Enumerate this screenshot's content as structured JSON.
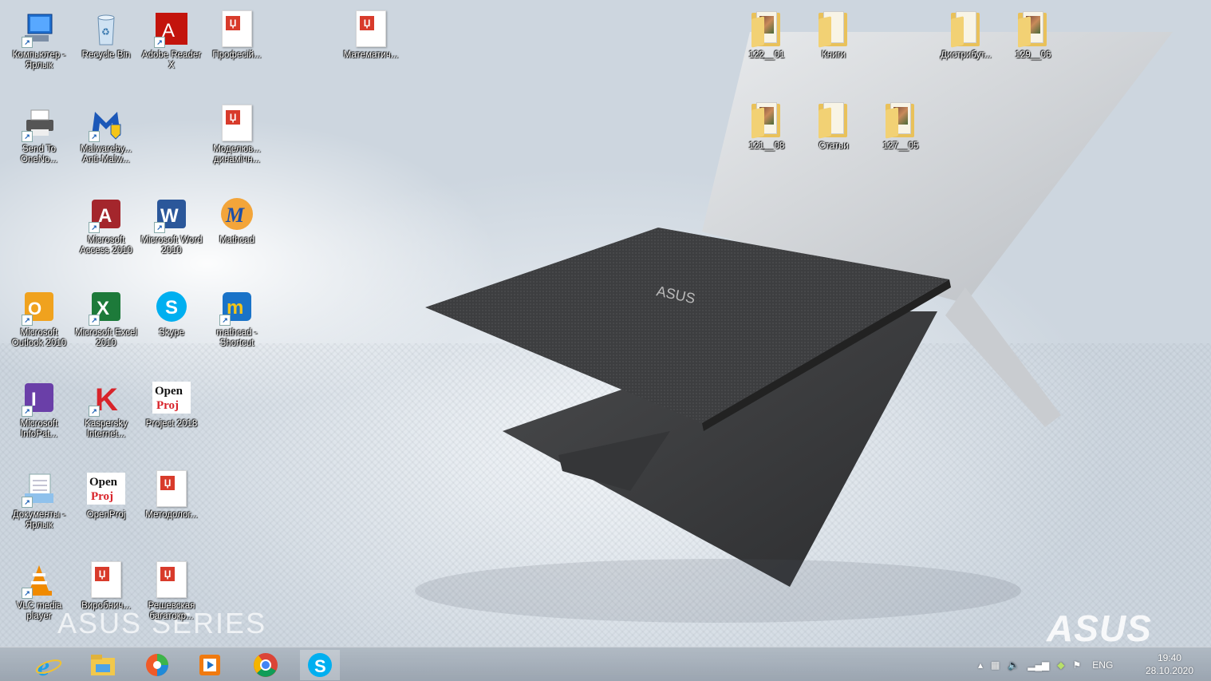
{
  "desktop": {
    "icons": [
      {
        "id": "computer",
        "label": "Компьютер - Ярлык",
        "icon": "computer-icon",
        "shortcut": true
      },
      {
        "id": "recycle",
        "label": "Recycle Bin",
        "icon": "recycle-bin-icon",
        "shortcut": false
      },
      {
        "id": "adobe",
        "label": "Adobe Reader X",
        "icon": "adobe-reader-icon",
        "shortcut": true
      },
      {
        "id": "prof",
        "label": "Професій...",
        "icon": "document-icon",
        "shortcut": false
      },
      {
        "id": "matem",
        "label": "Математич...",
        "icon": "document-icon",
        "shortcut": false
      },
      {
        "id": "sendto",
        "label": "Send To OneNo...",
        "icon": "printer-icon",
        "shortcut": true
      },
      {
        "id": "malware",
        "label": "Malwareby... Anti-Malw...",
        "icon": "malwarebytes-icon",
        "shortcut": true
      },
      {
        "id": "model",
        "label": "Моделюв... динамічн...",
        "icon": "document-icon",
        "shortcut": false
      },
      {
        "id": "access",
        "label": "Microsoft Access 2010",
        "icon": "access-icon",
        "shortcut": true
      },
      {
        "id": "word",
        "label": "Microsoft Word 2010",
        "icon": "word-icon",
        "shortcut": true
      },
      {
        "id": "mathcad",
        "label": "Mathcad",
        "icon": "mathcad-icon",
        "shortcut": false
      },
      {
        "id": "outlook",
        "label": "Microsoft Outlook 2010",
        "icon": "outlook-icon",
        "shortcut": true
      },
      {
        "id": "excel",
        "label": "Microsoft Excel 2010",
        "icon": "excel-icon",
        "shortcut": true
      },
      {
        "id": "skype",
        "label": "Skype",
        "icon": "skype-icon",
        "shortcut": false
      },
      {
        "id": "mathcad2",
        "label": "mathcad - Shortcut",
        "icon": "mathcad-m-icon",
        "shortcut": true
      },
      {
        "id": "infopath",
        "label": "Microsoft InfoPat...",
        "icon": "infopath-icon",
        "shortcut": true
      },
      {
        "id": "kaspersky",
        "label": "Kaspersky Internet...",
        "icon": "kaspersky-icon",
        "shortcut": true
      },
      {
        "id": "project",
        "label": "Project 2018",
        "icon": "openproj-icon",
        "shortcut": false
      },
      {
        "id": "docs",
        "label": "Документы - Ярлык",
        "icon": "documents-icon",
        "shortcut": true
      },
      {
        "id": "openproj",
        "label": "OpenProj",
        "icon": "openproj-icon",
        "shortcut": false
      },
      {
        "id": "metod",
        "label": "Методолог...",
        "icon": "document-icon",
        "shortcut": false
      },
      {
        "id": "vlc",
        "label": "VLC media player",
        "icon": "vlc-icon",
        "shortcut": true
      },
      {
        "id": "virob",
        "label": "Виробнич...",
        "icon": "document-icon",
        "shortcut": false
      },
      {
        "id": "reshev",
        "label": "Решевская багатокр...",
        "icon": "document-icon",
        "shortcut": false
      },
      {
        "id": "f122",
        "label": "122__01",
        "icon": "folder-icon",
        "shortcut": false
      },
      {
        "id": "knigi",
        "label": "Книги",
        "icon": "folder-icon",
        "shortcut": false
      },
      {
        "id": "distr",
        "label": "Дистрибут...",
        "icon": "folder-icon",
        "shortcut": false
      },
      {
        "id": "f129",
        "label": "129__06",
        "icon": "folder-icon",
        "shortcut": false
      },
      {
        "id": "f121",
        "label": "121__08",
        "icon": "folder-icon",
        "shortcut": false
      },
      {
        "id": "stati",
        "label": "Статьи",
        "icon": "folder-icon",
        "shortcut": false
      },
      {
        "id": "f127",
        "label": "127__05",
        "icon": "folder-icon",
        "shortcut": false
      }
    ],
    "wallpaper": {
      "series_text": "ASUS SERIES",
      "brand_text": "ASUS"
    }
  },
  "taskbar": {
    "apps": [
      "internet-explorer-icon",
      "file-explorer-icon",
      "chrome-like-icon",
      "media-player-icon",
      "chrome-icon",
      "skype-icon"
    ],
    "tray": {
      "language": "ENG",
      "time": "19:40",
      "date": "28.10.2020"
    }
  },
  "colors": {
    "accent": "#1a6fc4",
    "taskbar": "#a4aebb"
  }
}
